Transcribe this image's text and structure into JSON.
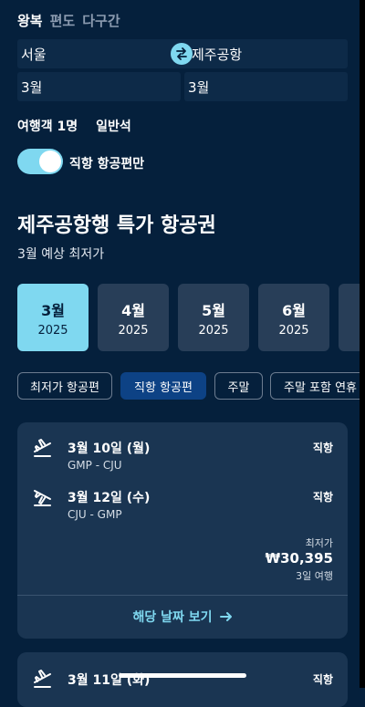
{
  "trip_types": [
    "왕복",
    "편도",
    "다구간"
  ],
  "search": {
    "origin": "서울",
    "destination": "제주공항",
    "depart_month": "3월",
    "return_month": "3월"
  },
  "travellers": {
    "count": "여행객 1명",
    "cabin": "일반석"
  },
  "direct_toggle": {
    "label": "직항 항공편만",
    "on": true
  },
  "section": {
    "title": "제주공항행 특가 항공권",
    "subtitle": "3월 예상 최저가"
  },
  "months": [
    {
      "name": "3월",
      "year": "2025"
    },
    {
      "name": "4월",
      "year": "2025"
    },
    {
      "name": "5월",
      "year": "2025"
    },
    {
      "name": "6월",
      "year": "2025"
    }
  ],
  "filters": [
    "최저가 항공편",
    "직항 항공편",
    "주말",
    "주말 포함 연휴"
  ],
  "deal": {
    "outbound": {
      "date": "3월 10일 (월)",
      "route": "GMP - CJU",
      "type": "직항"
    },
    "inbound": {
      "date": "3월 12일 (수)",
      "route": "CJU - GMP",
      "type": "직항"
    },
    "price_label": "최저가",
    "price": "₩30,395",
    "duration": "3일 여행",
    "action": "해당 날짜 보기"
  },
  "next_deal": {
    "date": "3월 11일 (화)",
    "type": "직항"
  },
  "colors": {
    "background": "#05203c",
    "accent": "#7fd8f0",
    "card": "#1a3552",
    "chip_active": "#0d4285"
  }
}
